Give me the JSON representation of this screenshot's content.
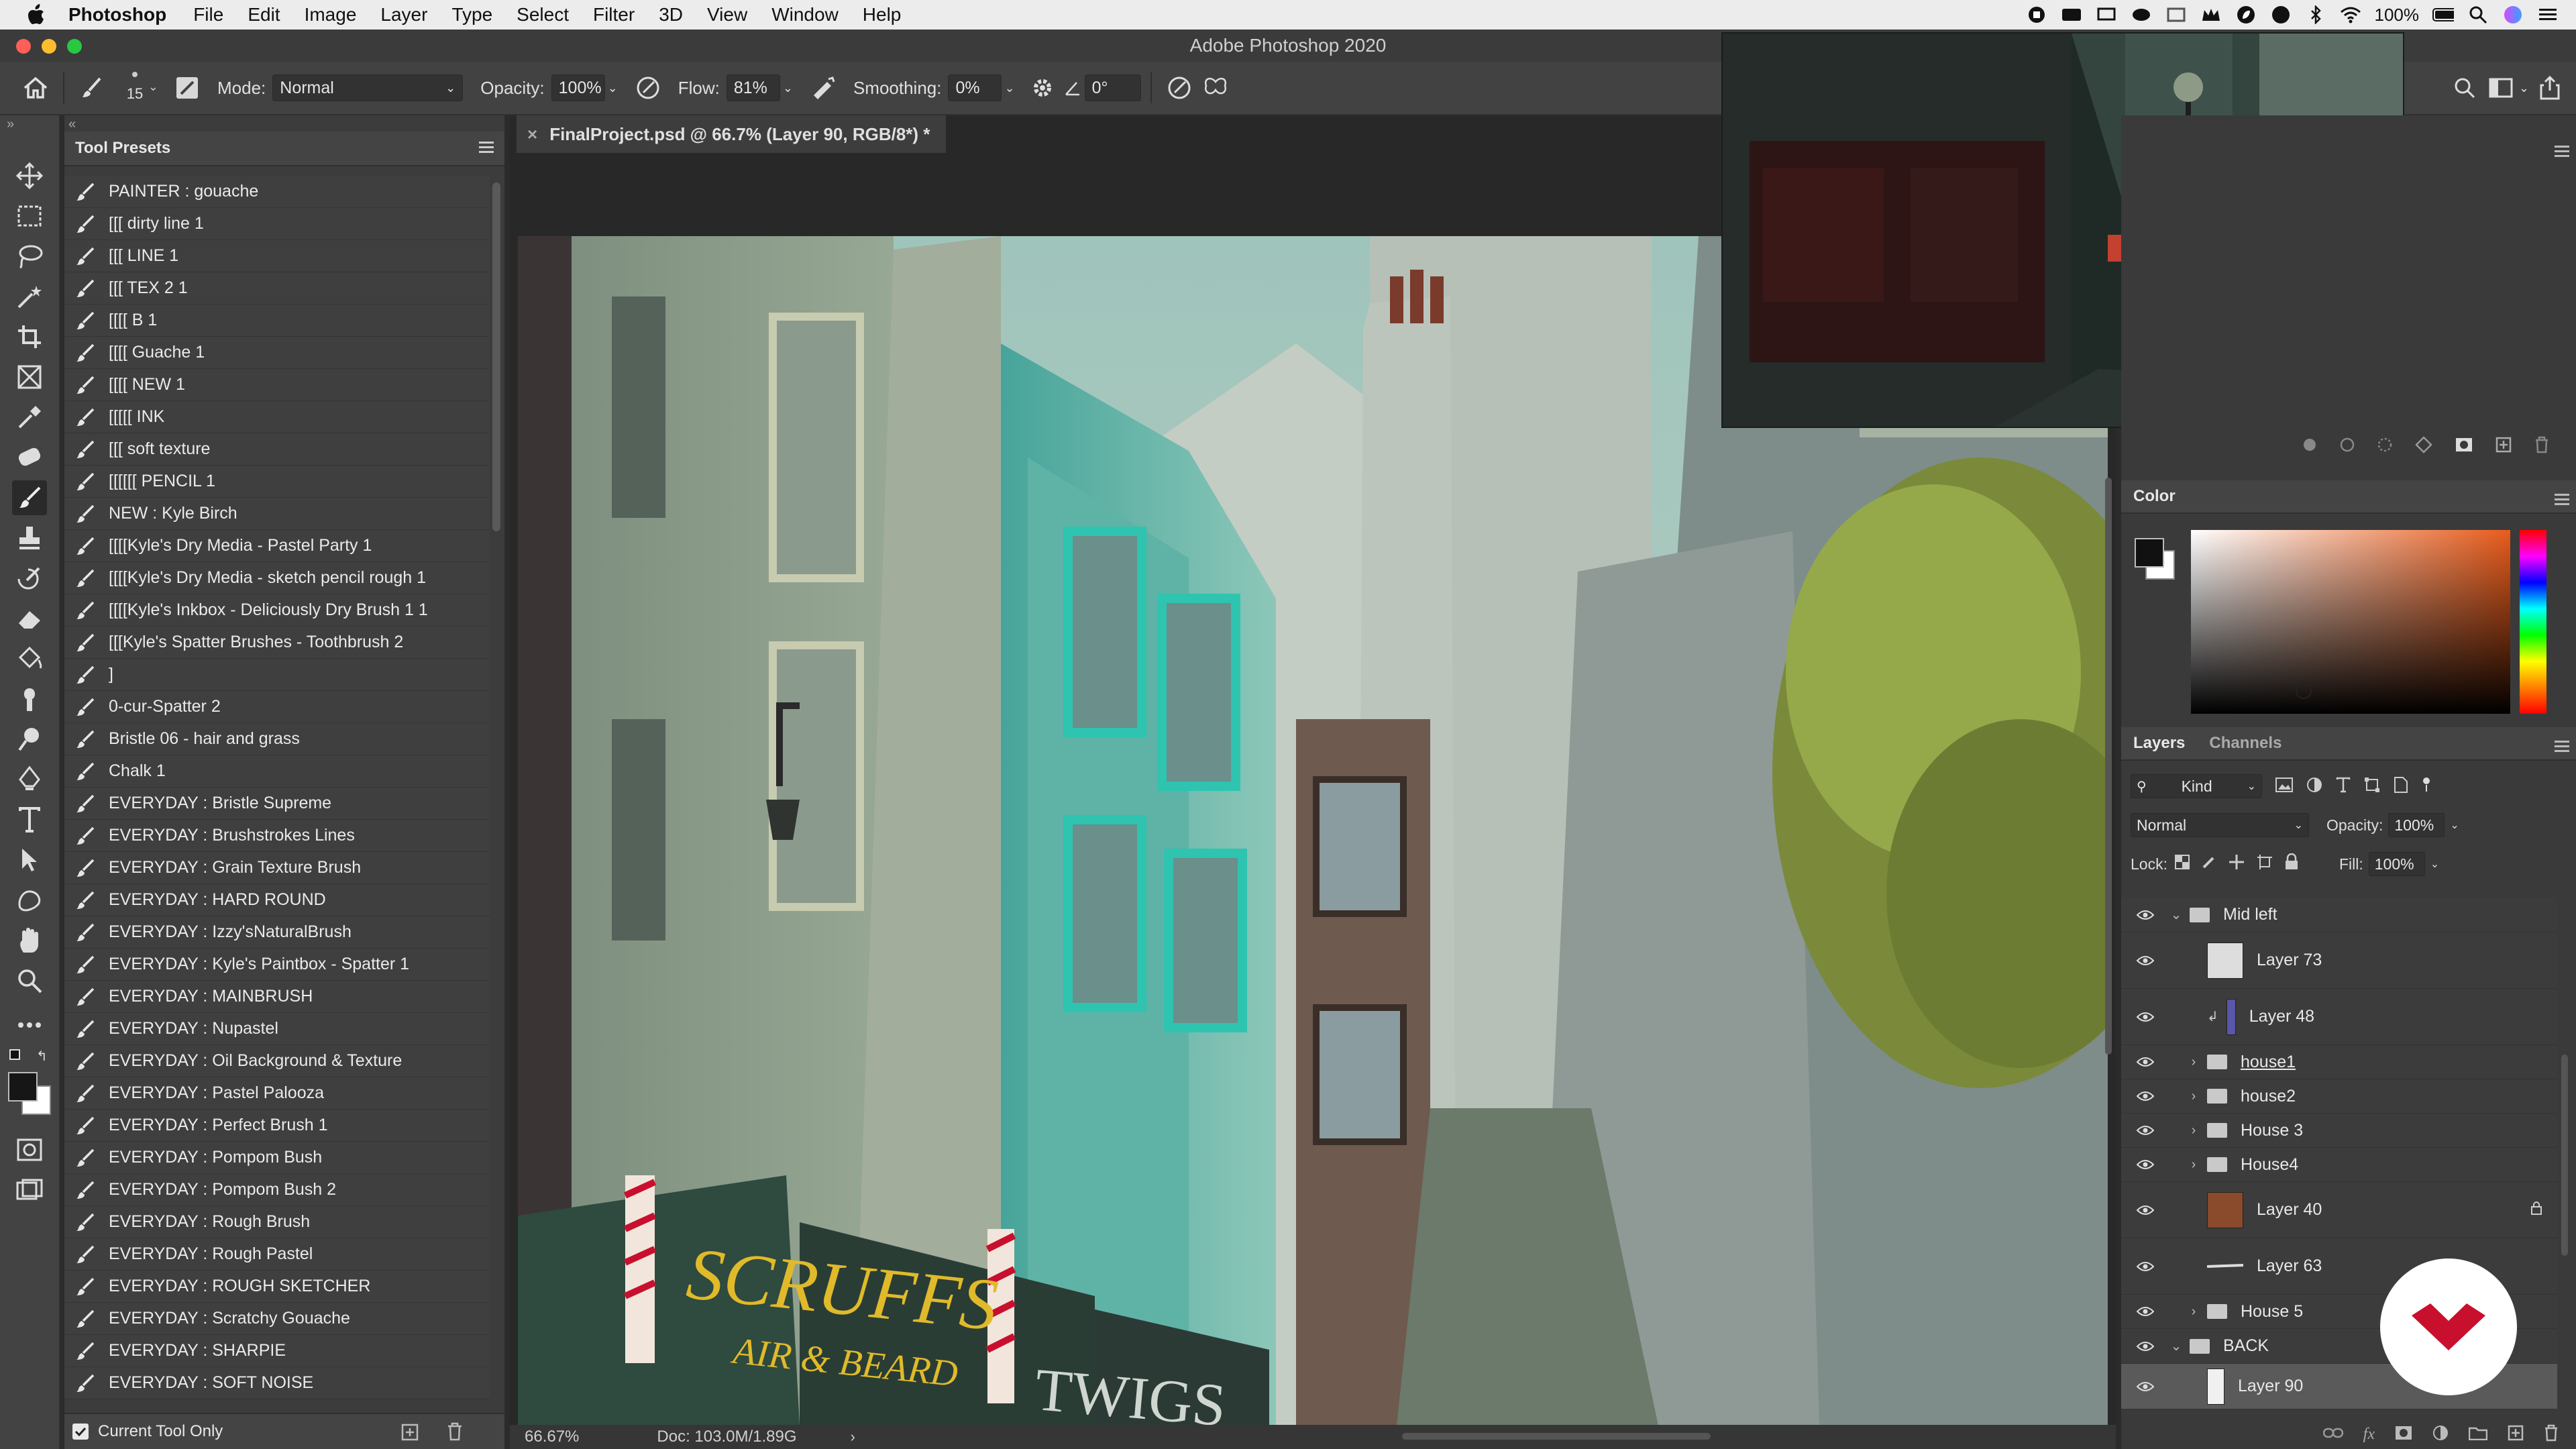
{
  "menubar": {
    "app_name": "Photoshop",
    "items": [
      "File",
      "Edit",
      "Image",
      "Layer",
      "Type",
      "Select",
      "Filter",
      "3D",
      "View",
      "Window",
      "Help"
    ],
    "battery": "100%"
  },
  "window": {
    "title": "Adobe Photoshop 2020"
  },
  "options": {
    "brush_size": "15",
    "mode_label": "Mode:",
    "mode_value": "Normal",
    "opacity_label": "Opacity:",
    "opacity_value": "100%",
    "flow_label": "Flow:",
    "flow_value": "81%",
    "smoothing_label": "Smoothing:",
    "smoothing_value": "0%",
    "angle_value": "0°"
  },
  "presets": {
    "title": "Tool Presets",
    "items": [
      "PAINTER : gouache",
      "[[[ dirty line 1",
      "[[[ LINE 1",
      "[[[ TEX 2 1",
      "[[[[ B 1",
      "[[[[ Guache 1",
      "[[[[ NEW 1",
      "[[[[[ INK",
      "[[[ soft texture",
      "[[[[[[ PENCIL 1",
      "NEW : Kyle Birch",
      "[[[[Kyle's Dry Media - Pastel Party 1",
      "[[[[Kyle's Dry Media - sketch pencil rough 1",
      "[[[[Kyle's Inkbox - Deliciously Dry Brush 1 1",
      "[[[Kyle's Spatter Brushes - Toothbrush 2",
      "]",
      "0-cur-Spatter 2",
      "Bristle 06 - hair and grass",
      "Chalk 1",
      "EVERYDAY : Bristle Supreme",
      "EVERYDAY : Brushstrokes Lines",
      "EVERYDAY : Grain Texture Brush",
      "EVERYDAY : HARD ROUND",
      "EVERYDAY : Izzy'sNaturalBrush",
      "EVERYDAY : Kyle's Paintbox - Spatter 1",
      "EVERYDAY : MAINBRUSH",
      "EVERYDAY : Nupastel",
      "EVERYDAY : Oil Background & Texture",
      "EVERYDAY : Pastel Palooza",
      "EVERYDAY : Perfect Brush 1",
      "EVERYDAY : Pompom Bush",
      "EVERYDAY : Pompom Bush 2",
      "EVERYDAY : Rough Brush",
      "EVERYDAY : Rough Pastel",
      "EVERYDAY : ROUGH SKETCHER",
      "EVERYDAY : Scratchy Gouache",
      "EVERYDAY : SHARPIE",
      "EVERYDAY : SOFT NOISE"
    ],
    "current_tool_only": "Current Tool Only"
  },
  "document": {
    "tab_title": "FinalProject.psd @ 66.7% (Layer 90, RGB/8*) *",
    "zoom": "66.67%",
    "doc_size": "Doc: 103.0M/1.89G",
    "sign_text": "SCRUFFS",
    "sign_sub": "AIR & BEARD",
    "sign2_text": "TWIGS"
  },
  "color_panel": {
    "title": "Color"
  },
  "layers_panel": {
    "tabs": [
      "Layers",
      "Channels"
    ],
    "kind": "Kind",
    "blend": "Normal",
    "opacity_label": "Opacity:",
    "opacity_value": "100%",
    "lock_label": "Lock:",
    "fill_label": "Fill:",
    "fill_value": "100%",
    "layers": [
      {
        "name": "Mid left",
        "type": "group-open"
      },
      {
        "name": "Layer 73",
        "type": "layer"
      },
      {
        "name": "Layer 48",
        "type": "clipped"
      },
      {
        "name": "house1",
        "type": "group"
      },
      {
        "name": "house2",
        "type": "group"
      },
      {
        "name": "House 3",
        "type": "group"
      },
      {
        "name": "House4",
        "type": "group"
      },
      {
        "name": "Layer 40",
        "type": "layer-locked"
      },
      {
        "name": "Layer 63",
        "type": "layer"
      },
      {
        "name": "House 5",
        "type": "group"
      },
      {
        "name": "BACK",
        "type": "group-open"
      },
      {
        "name": "Layer 90",
        "type": "layer-selected"
      }
    ]
  },
  "colors": {
    "accent": "#e0ba2a",
    "brand_red": "#c8102e",
    "teal": "#2ec4b0"
  }
}
